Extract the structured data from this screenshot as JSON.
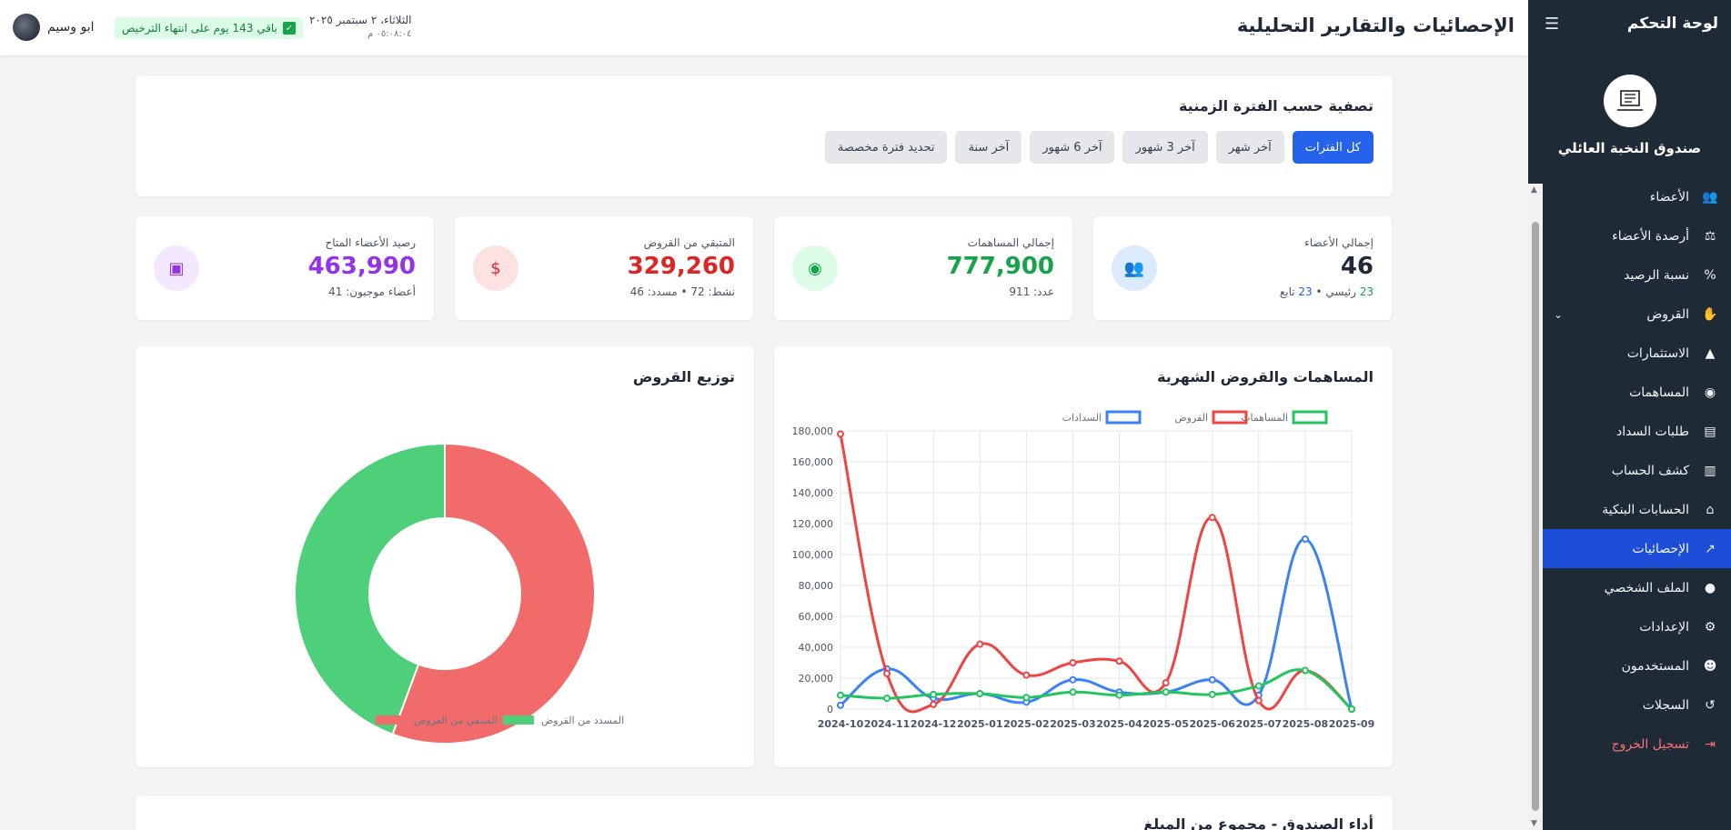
{
  "sidebar": {
    "title": "لوحة التحكم",
    "fund_name": "صندوق النخبة العائلي",
    "logo_text": "صندوق النخبة",
    "items": [
      {
        "label": "الأعضاء",
        "icon": "users-icon",
        "glyph": "👥"
      },
      {
        "label": "أرصدة الأعضاء",
        "icon": "scale-icon",
        "glyph": "⚖"
      },
      {
        "label": "نسبة الرصيد",
        "icon": "percent-icon",
        "glyph": "%"
      },
      {
        "label": "القروض",
        "icon": "hand-coin-icon",
        "glyph": "✋"
      },
      {
        "label": "الاستثمارات",
        "icon": "chart-area-icon",
        "glyph": "▲"
      },
      {
        "label": "المساهمات",
        "icon": "coins-icon",
        "glyph": "◉"
      },
      {
        "label": "طلبات السداد",
        "icon": "file-icon",
        "glyph": "▤"
      },
      {
        "label": "كشف الحساب",
        "icon": "file-invoice-icon",
        "glyph": "▥"
      },
      {
        "label": "الحسابات البنكية",
        "icon": "bank-icon",
        "glyph": "⌂"
      },
      {
        "label": "الإحصائيات",
        "icon": "chart-line-icon",
        "glyph": "↗"
      },
      {
        "label": "الملف الشخصي",
        "icon": "user-icon",
        "glyph": "●"
      },
      {
        "label": "الإعدادات",
        "icon": "gear-icon",
        "glyph": "⚙"
      },
      {
        "label": "المستخدمون",
        "icon": "user-gear-icon",
        "glyph": "☻"
      },
      {
        "label": "السجلات",
        "icon": "history-icon",
        "glyph": "↺"
      },
      {
        "label": "تسجيل الخروج",
        "icon": "logout-icon",
        "glyph": "⇥"
      }
    ]
  },
  "header": {
    "title": "الإحصائيات والتقارير التحليلية",
    "user_name": "ابو وسيم",
    "license": "باقي 143 يوم على انتهاء الترخيص",
    "date": "الثلاثاء، ٢ سبتمبر ٢٠٢٥",
    "time": "٠٥:٠٨:٠٤ م"
  },
  "filter": {
    "title": "تصفية حسب الفترة الزمنية",
    "buttons": [
      "كل الفترات",
      "آخر شهر",
      "آخر 3 شهور",
      "آخر 6 شهور",
      "آخر سنة",
      "تحديد فترة مخصصة"
    ],
    "active_index": 0
  },
  "stats": [
    {
      "label": "إجمالي الأعضاء",
      "value": "46",
      "sub_a": "23",
      "sub_a_text": "رئيسي",
      "sub_b": "23",
      "sub_b_text": "تابع",
      "color": "#1f2937",
      "icon": "users-icon",
      "glyph": "👥",
      "icon_bg": "#dbeafe",
      "icon_color": "#2563eb"
    },
    {
      "label": "إجمالي المساهمات",
      "value": "777,900",
      "sub": "عدد: 911",
      "color": "#16a34a",
      "icon": "coins-icon",
      "glyph": "◉",
      "icon_bg": "#dcfce7",
      "icon_color": "#16a34a"
    },
    {
      "label": "المتبقي من القروض",
      "value": "329,260",
      "sub": "نشط: 72 • مسدد: 46",
      "color": "#dc2626",
      "icon": "hand-dollar-icon",
      "glyph": "$",
      "icon_bg": "#fee2e2",
      "icon_color": "#dc2626"
    },
    {
      "label": "رصيد الأعضاء المتاح",
      "value": "463,990",
      "sub": "أعضاء موجبون: 41",
      "color": "#9333ea",
      "icon": "wallet-icon",
      "glyph": "▣",
      "icon_bg": "#f3e8ff",
      "icon_color": "#9333ea"
    }
  ],
  "line_chart_title": "المساهمات والقروض الشهرية",
  "pie_chart_title": "توزيع القروض",
  "bottom_title": "أداء الصندوق - مجموع من المبلغ",
  "chart_data": [
    {
      "type": "line",
      "title": "المساهمات والقروض الشهرية",
      "x": [
        "2024-10",
        "2024-11",
        "2024-12",
        "2025-01",
        "2025-02",
        "2025-03",
        "2025-04",
        "2025-05",
        "2025-06",
        "2025-07",
        "2025-08",
        "2025-09"
      ],
      "ylim": [
        0,
        180000
      ],
      "yticks": [
        "0",
        "20,000",
        "40,000",
        "60,000",
        "80,000",
        "100,000",
        "120,000",
        "140,000",
        "160,000",
        "180,000"
      ],
      "grid": true,
      "legend": "top",
      "series": [
        {
          "name": "السدادات",
          "color": "#3b82f6",
          "values": [
            2500,
            26000,
            7000,
            10000,
            4500,
            19000,
            11000,
            11000,
            19000,
            9000,
            110000,
            0
          ]
        },
        {
          "name": "القروض",
          "color": "#ef4444",
          "values": [
            178000,
            23000,
            3000,
            42000,
            22000,
            30000,
            31000,
            17000,
            124000,
            5500,
            25000,
            0
          ]
        },
        {
          "name": "المساهمات",
          "color": "#22c55e",
          "values": [
            9000,
            7000,
            9500,
            10000,
            7500,
            11000,
            9000,
            11000,
            9500,
            15000,
            25000,
            0
          ]
        }
      ]
    },
    {
      "type": "pie",
      "title": "توزيع القروض",
      "legend": "bottom",
      "series": [
        {
          "name": "المتبقي من القروض",
          "color": "#f26b6b",
          "value": 329260
        },
        {
          "name": "المسدد من القروض",
          "color": "#4ecf7a",
          "value": 262260
        }
      ]
    }
  ]
}
